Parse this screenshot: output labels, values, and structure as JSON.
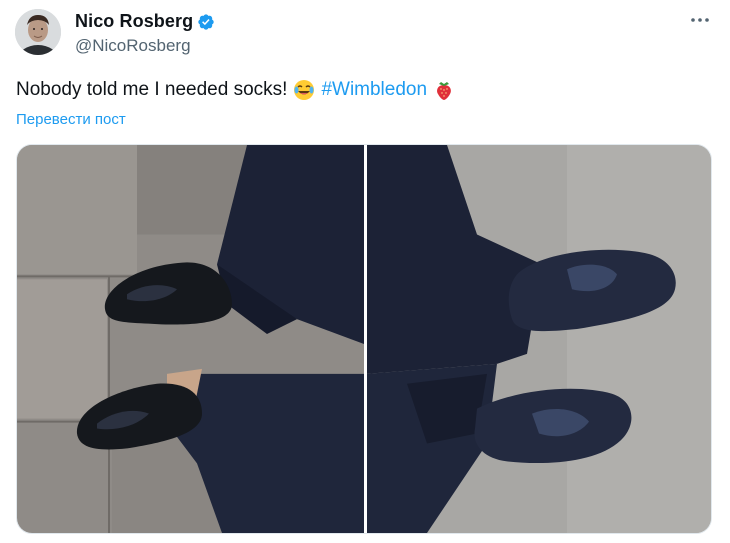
{
  "tweet": {
    "display_name": "Nico Rosberg",
    "handle": "@NicoRosberg",
    "verified": true,
    "verified_color": "#1d9bf0",
    "text_main": "Nobody told me I needed socks!",
    "text_emoji_1": "laughing-tears-emoji",
    "hashtag": "#Wimbledon",
    "text_emoji_2": "strawberry-emoji",
    "translate_label": "Перевести пост",
    "accent_color": "#1d9bf0",
    "menu_icon": "more-horizontal-icon"
  },
  "media": {
    "count": 2,
    "photos": [
      "left-photo",
      "right-photo"
    ]
  }
}
